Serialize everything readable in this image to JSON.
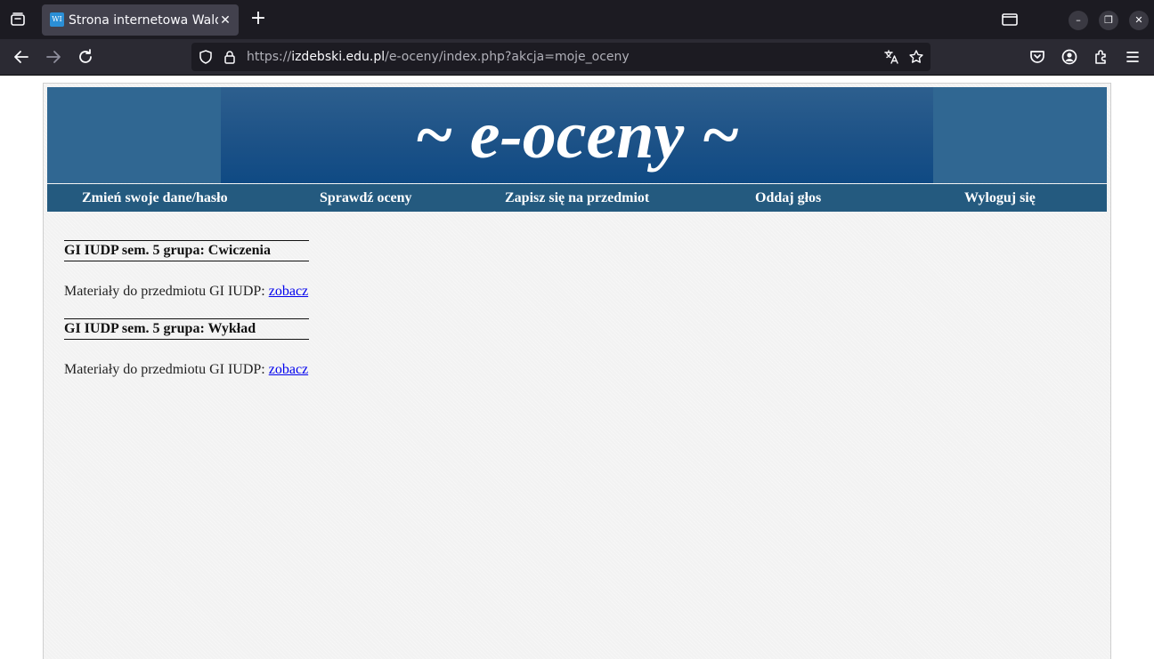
{
  "browser": {
    "tab": {
      "favicon_text": "WI",
      "title": "Strona internetowa Wald",
      "close_glyph": "✕"
    },
    "new_tab_glyph": "+",
    "window_controls": {
      "minimize_glyph": "–",
      "restore_glyph": "❐",
      "close_glyph": "✕"
    },
    "url": {
      "scheme": "https://",
      "host": "izdebski.edu.pl",
      "path": "/e-oceny/index.php?akcja=moje_oceny"
    },
    "icons": [
      "tab-list-icon",
      "back-icon",
      "forward-icon",
      "reload-icon",
      "shield-icon",
      "lock-icon",
      "translate-icon",
      "bookmark-star-icon",
      "pocket-icon",
      "account-icon",
      "extensions-icon",
      "menu-icon",
      "window-tabs-icon"
    ]
  },
  "page": {
    "banner_title": "~ e-oceny ~",
    "menu": [
      {
        "label": "Zmień swoje dane/hasło"
      },
      {
        "label": "Sprawdź oceny"
      },
      {
        "label": "Zapisz się na przedmiot"
      },
      {
        "label": "Oddaj głos"
      },
      {
        "label": "Wyloguj się"
      }
    ],
    "sections": [
      {
        "heading": "GI IUDP sem. 5 grupa: Cwiczenia",
        "materials_text": "Materiały do przedmiotu GI IUDP: ",
        "link": "zobacz"
      },
      {
        "heading": "GI IUDP sem. 5 grupa: Wykład",
        "materials_text": "Materiały do przedmiotu GI IUDP: ",
        "link": "zobacz"
      }
    ]
  },
  "colors": {
    "chrome_dark": "#1c1b22",
    "toolbar": "#2b2a33",
    "banner": "#306792",
    "menu_bar": "#245a7f",
    "link": "#0000ee"
  }
}
